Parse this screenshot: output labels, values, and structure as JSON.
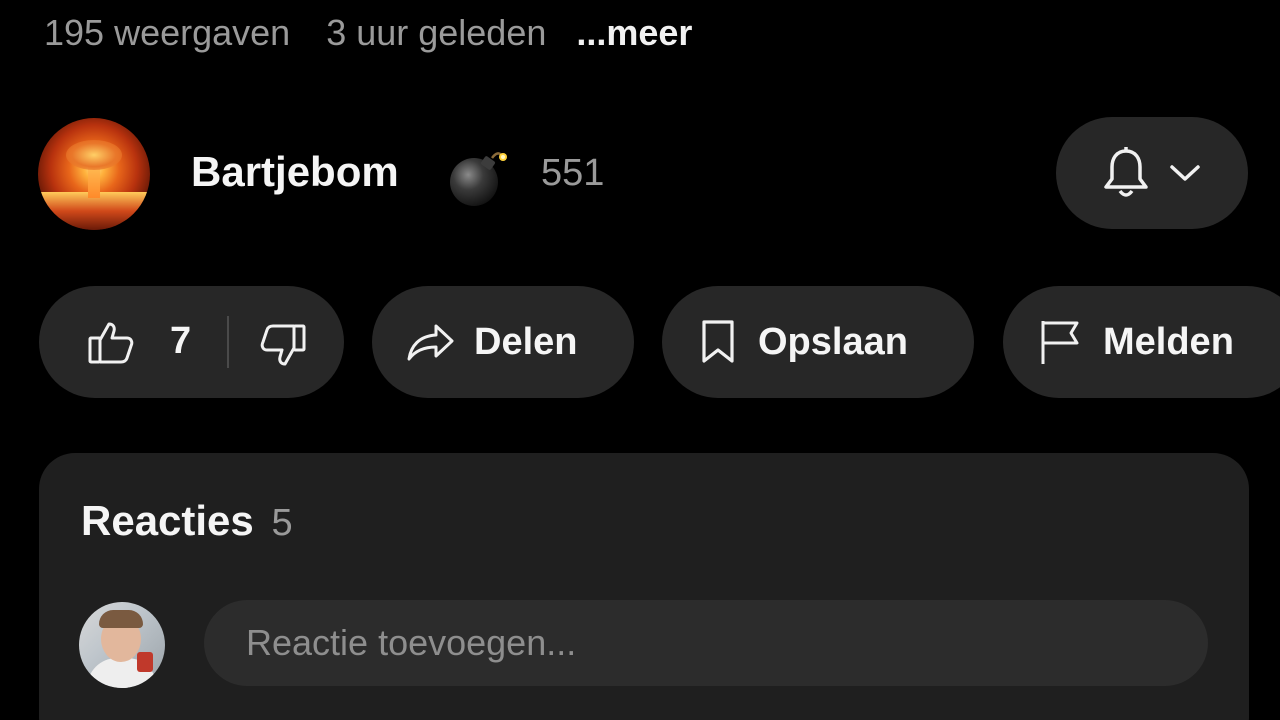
{
  "video_meta": {
    "views": "195 weergaven",
    "age": "3 uur geleden",
    "more_label": "...meer"
  },
  "channel": {
    "name": "Bartjebom",
    "emoji_icon": "bomb-icon",
    "subscribers": "551",
    "notification_icon": "bell-icon",
    "dropdown_icon": "chevron-down-icon"
  },
  "actions": {
    "like_count": "7",
    "like_icon": "thumbs-up-icon",
    "dislike_icon": "thumbs-down-icon",
    "share_label": "Delen",
    "share_icon": "share-arrow-icon",
    "save_label": "Opslaan",
    "save_icon": "bookmark-icon",
    "report_label": "Melden",
    "report_icon": "flag-icon"
  },
  "comments": {
    "title": "Reacties",
    "count": "5",
    "input_placeholder": "Reactie toevoegen..."
  },
  "colors": {
    "background": "#000000",
    "pill": "#272727",
    "card": "#1f1f1f",
    "input": "#2c2c2c",
    "text_primary": "#f1f1f1",
    "text_secondary": "#9a9a9a"
  }
}
